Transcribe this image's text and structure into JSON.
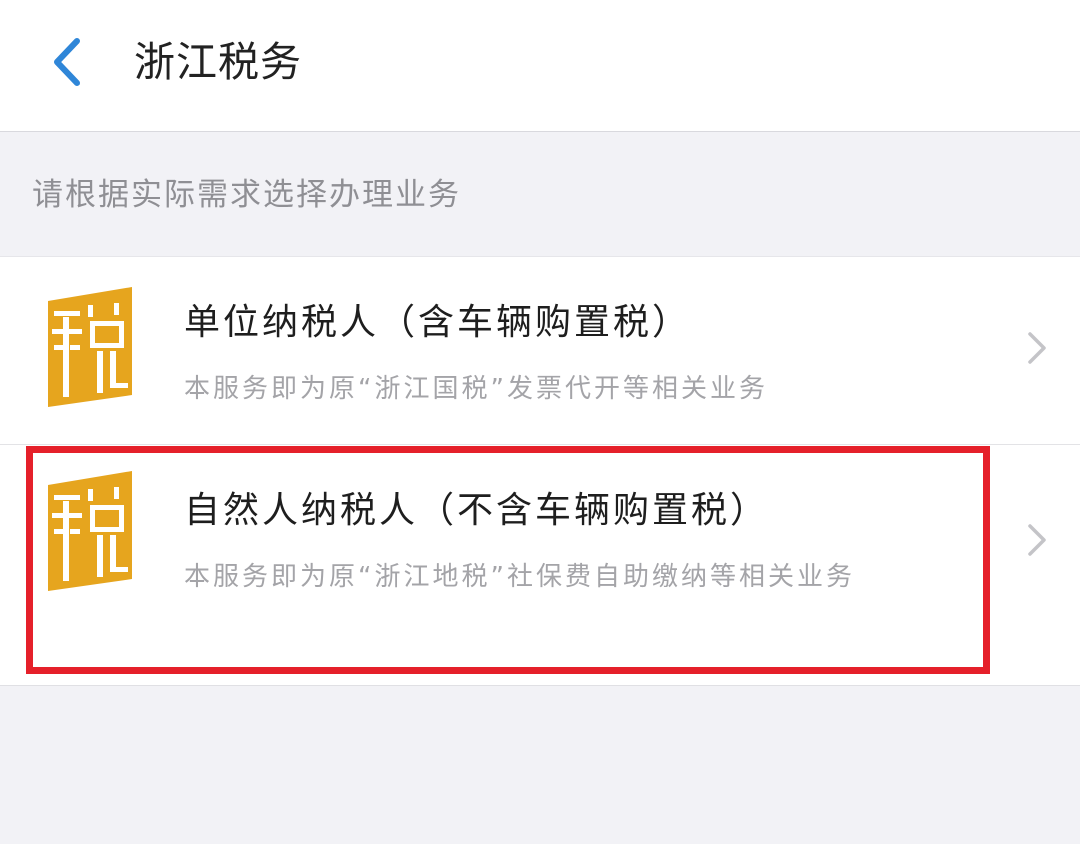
{
  "nav": {
    "title": "浙江税务",
    "back_icon": "chevron-left-icon"
  },
  "section_header": "请根据实际需求选择办理业务",
  "items": [
    {
      "title": "单位纳税人（含车辆购置税）",
      "description": "本服务即为原“浙江国税”发票代开等相关业务",
      "icon": "tax-character-icon",
      "chevron": "chevron-right-icon"
    },
    {
      "title": "自然人纳税人（不含车辆购置税）",
      "description": "本服务即为原“浙江地税”社保费自助缴纳等相关业务",
      "icon": "tax-character-icon",
      "chevron": "chevron-right-icon"
    }
  ],
  "colors": {
    "accent_blue": "#2f86d8",
    "icon_gold": "#e6a51e",
    "highlight_red": "#e5202a",
    "background": "#f2f2f6"
  }
}
